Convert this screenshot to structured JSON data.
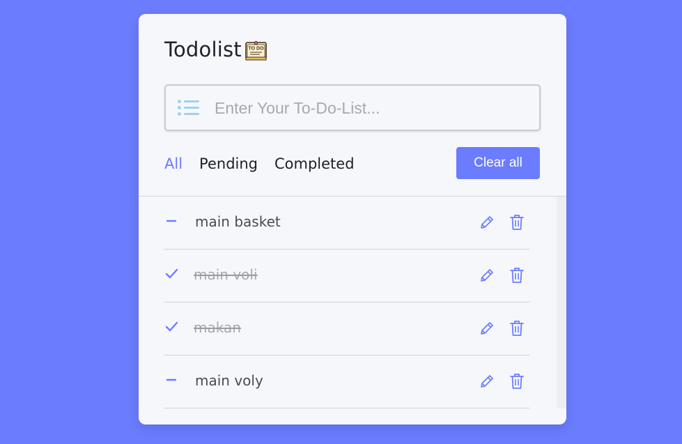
{
  "app": {
    "title": "Todolist",
    "brand_color": "#6b7cff",
    "background": "#6b7cff",
    "card_background": "#f6f7fb"
  },
  "input": {
    "placeholder": "Enter Your To-Do-List...",
    "value": "",
    "icon": "list-icon"
  },
  "filters": {
    "all": "All",
    "pending": "Pending",
    "completed": "Completed",
    "active": "all"
  },
  "actions": {
    "clear_all": "Clear all"
  },
  "tasks": [
    {
      "label": "main basket",
      "completed": false
    },
    {
      "label": "main voli",
      "completed": true
    },
    {
      "label": "makan",
      "completed": true
    },
    {
      "label": "main voly",
      "completed": false
    }
  ]
}
